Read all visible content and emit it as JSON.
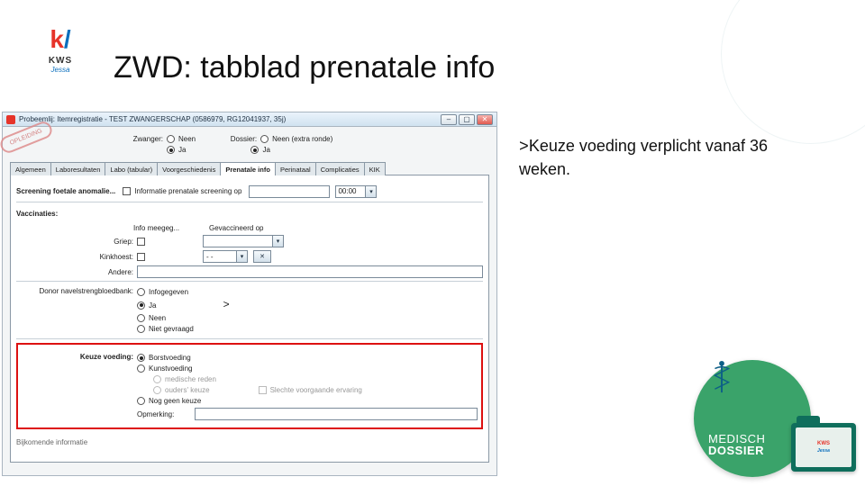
{
  "logo": {
    "text": "KWS",
    "sub": "Jessa"
  },
  "title": "ZWD: tabblad prenatale info",
  "note_arrow": ">",
  "note": "Keuze voeding verplicht vanaf 36 weken.",
  "window": {
    "title": "Probeemlij: Itemregistratie - TEST ZWANGERSCHAP  (0586979, RG12041937, 35j)",
    "stamp": "OPLEIDING",
    "header": {
      "zwanger_label": "Zwanger:",
      "dossier_label": "Dossier:",
      "opt_neen": "Neen",
      "opt_neen_extra": "Neen (extra ronde)",
      "opt_ja": "Ja",
      "opt_ja2": "Ja"
    },
    "tabs": [
      "Algemeen",
      "Laboresultaten",
      "Labo (tabular)",
      "Voorgeschiedenis",
      "Prenatale info",
      "Perinataal",
      "Complicaties",
      "KIK"
    ],
    "active_tab_index": 4,
    "screening": {
      "title": "Screening foetale anomalie...",
      "info_label": "Informatie prenatale screening op",
      "time": "00:00"
    },
    "vacc": {
      "title": "Vaccinaties:",
      "col_info": "Info meegeg...",
      "col_date": "Gevaccineerd op",
      "griep": "Griep:",
      "kinkhoest": "Kinkhoest:",
      "andere": "Andere:",
      "dash": "- -"
    },
    "donor": {
      "title": "Donor navelstrengbloedbank:",
      "opt_info": "Infogegeven",
      "opt_ja": "Ja",
      "opt_neen": "Neen",
      "opt_niet": "Niet gevraagd"
    },
    "voeding": {
      "title": "Keuze voeding:",
      "opt_borst": "Borstvoeding",
      "opt_kunst": "Kunstvoeding",
      "sub_med": "medische reden",
      "sub_choice": "ouders' keuze",
      "chk_slechte": "Slechte voorgaande ervaring",
      "opt_nog": "Nog geen keuze",
      "opmerking": "Opmerking:"
    },
    "bottom": "Bijkomende informatie"
  },
  "badge": {
    "line1": "MEDISCH",
    "line2": "DOSSIER",
    "mini1": "KWS",
    "mini2": "Jessa"
  }
}
